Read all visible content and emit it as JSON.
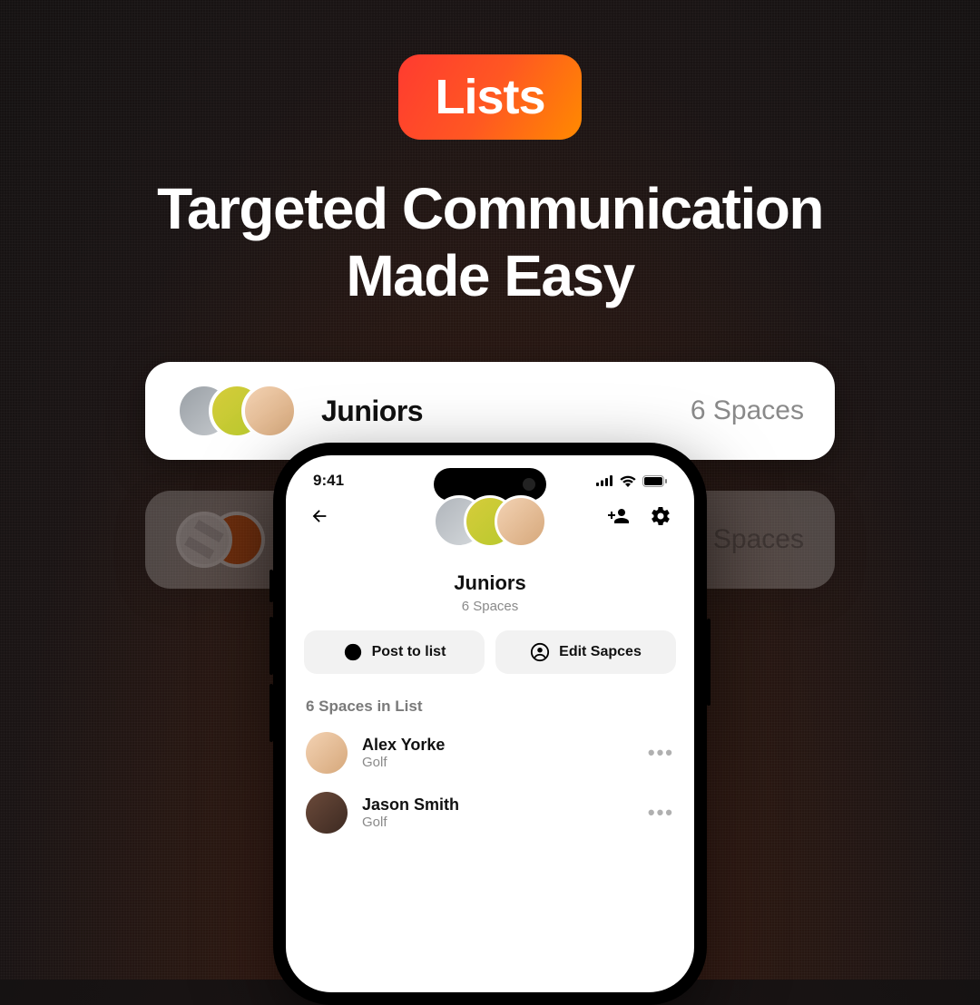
{
  "hero": {
    "badge": "Lists",
    "headline_line1": "Targeted Communication",
    "headline_line2": "Made Easy"
  },
  "cards": {
    "front": {
      "title": "Juniors",
      "count": "6 Spaces"
    },
    "back": {
      "title": "",
      "count": "Spaces"
    }
  },
  "phone": {
    "status": {
      "time": "9:41"
    },
    "list": {
      "title": "Juniors",
      "subtitle": "6 Spaces"
    },
    "actions": {
      "post": "Post to list",
      "edit": "Edit Sapces"
    },
    "section_header": "6 Spaces in List",
    "members": [
      {
        "name": "Alex Yorke",
        "role": "Golf"
      },
      {
        "name": "Jason Smith",
        "role": "Golf"
      }
    ]
  }
}
